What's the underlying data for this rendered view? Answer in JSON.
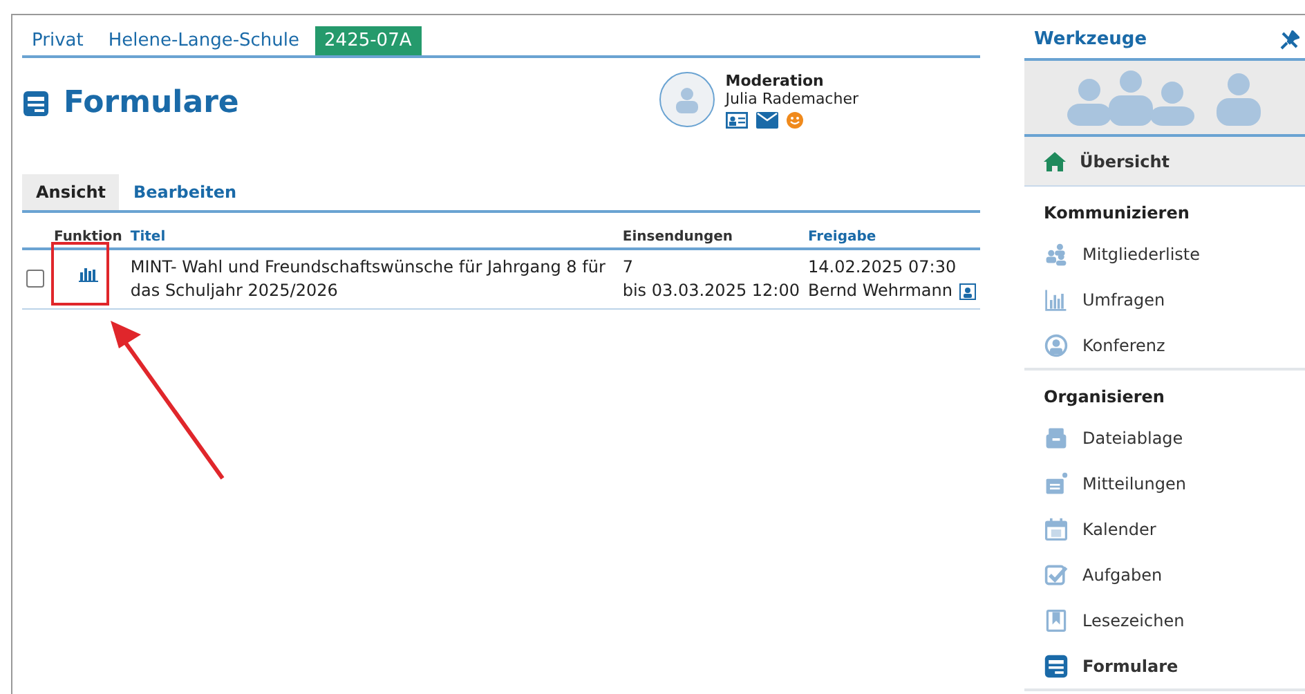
{
  "breadcrumb": [
    {
      "label": "Privat",
      "selected": false
    },
    {
      "label": "Helene-Lange-Schule",
      "selected": false
    },
    {
      "label": "2425-07A",
      "selected": true
    }
  ],
  "page_title": "Formulare",
  "moderation": {
    "role": "Moderation",
    "name": "Julia Rademacher"
  },
  "tabs": [
    {
      "label": "Ansicht",
      "selected": true
    },
    {
      "label": "Bearbeiten",
      "selected": false
    }
  ],
  "table": {
    "columns": [
      {
        "label": "Funktion",
        "sortable": false
      },
      {
        "label": "Titel",
        "sortable": true
      },
      {
        "label": "Einsendungen",
        "sortable": false
      },
      {
        "label": "Freigabe",
        "sortable": true
      }
    ],
    "rows": [
      {
        "checked": false,
        "title": "MINT- Wahl und Freundschaftswünsche für Jahrgang 8 für das Schuljahr 2025/2026",
        "submissions": "7",
        "deadline": "bis 03.03.2025 12:00",
        "released": "14.02.2025 07:30",
        "released_by": "Bernd Wehrmann"
      }
    ]
  },
  "sidebar": {
    "title": "Werkzeuge",
    "overview": {
      "label": "Übersicht",
      "selected": true
    },
    "groups": [
      {
        "heading": "Kommunizieren",
        "items": [
          {
            "label": "Mitgliederliste",
            "selected": false
          },
          {
            "label": "Umfragen",
            "selected": false
          },
          {
            "label": "Konferenz",
            "selected": false
          }
        ]
      },
      {
        "heading": "Organisieren",
        "items": [
          {
            "label": "Dateiablage",
            "selected": false
          },
          {
            "label": "Mitteilungen",
            "selected": false
          },
          {
            "label": "Kalender",
            "selected": false
          },
          {
            "label": "Aufgaben",
            "selected": false
          },
          {
            "label": "Lesezeichen",
            "selected": false
          },
          {
            "label": "Formulare",
            "selected": true
          }
        ]
      }
    ]
  }
}
